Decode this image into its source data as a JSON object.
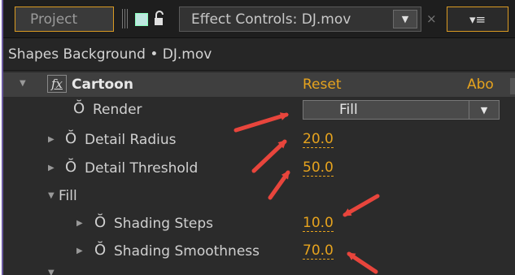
{
  "tabs": {
    "project_label": "Project",
    "effect_controls_label": "Effect Controls: DJ.mov",
    "dropdown_glyph": "▼",
    "close_glyph": "×",
    "menu_glyph": "▾≡",
    "lock_glyph": "🔓"
  },
  "clip_header": "Shapes Background • DJ.mov",
  "effect": {
    "name": "Cartoon",
    "fx_label": "fx",
    "reset_label": "Reset",
    "about_label": "Abo"
  },
  "properties": [
    {
      "label": "Render",
      "type": "select",
      "value": "Fill"
    },
    {
      "label": "Detail Radius",
      "value": "20.0"
    },
    {
      "label": "Detail Threshold",
      "value": "50.0"
    },
    {
      "label": "Fill",
      "type": "group"
    },
    {
      "label": "Shading Steps",
      "value": "10.0"
    },
    {
      "label": "Shading Smoothness",
      "value": "70.0"
    }
  ],
  "colors": {
    "accent_orange": "#e6a31e",
    "annotation_red": "#e8453c",
    "panel_bg": "#2b2b2b"
  },
  "icons": [
    "stopwatch-icon",
    "expand-triangle-icon",
    "fx-icon",
    "lock-icon",
    "panel-menu-icon"
  ]
}
